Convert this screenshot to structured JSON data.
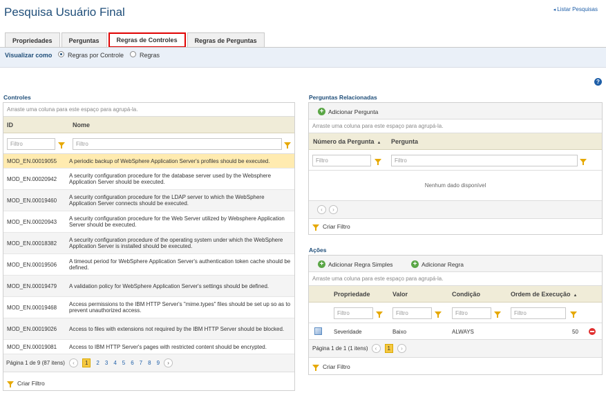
{
  "title": "Pesquisa Usuário Final",
  "top_link": "Listar Pesquisas",
  "tabs": [
    "Propriedades",
    "Perguntas",
    "Regras de Controles",
    "Regras de Perguntas"
  ],
  "view": {
    "label": "Visualizar como",
    "opt1": "Regras por Controle",
    "opt2": "Regras"
  },
  "help": "?",
  "controles": {
    "title": "Controles",
    "group_hint": "Arraste uma coluna para este espaço para agrupá-la.",
    "col_id": "ID",
    "col_nome": "Nome",
    "filter_placeholder": "Filtro",
    "rows": [
      {
        "id": "MOD_EN.00019055",
        "nome": "A periodic backup of WebSphere Application Server's profiles should be executed."
      },
      {
        "id": "MOD_EN.00020942",
        "nome": "A security configuration procedure for the database server used by the Websphere Application Server should be executed."
      },
      {
        "id": "MOD_EN.00019460",
        "nome": "A security configuration procedure for the LDAP server to which the WebSphere Application Server connects should be executed."
      },
      {
        "id": "MOD_EN.00020943",
        "nome": "A security configuration procedure for the Web Server utilized by Websphere Application Server should be executed."
      },
      {
        "id": "MOD_EN.00018382",
        "nome": "A security configuration procedure of the operating system under which the WebSphere Application Server is installed should be executed."
      },
      {
        "id": "MOD_EN.00019506",
        "nome": "A timeout period for WebSphere Application Server's authentication token cache should be defined."
      },
      {
        "id": "MOD_EN.00019479",
        "nome": "A validation policy for WebSphere Application Server's settings should be defined."
      },
      {
        "id": "MOD_EN.00019468",
        "nome": "Access permissions to the IBM HTTP Server's \"mime.types\" files should be set up so as to prevent unauthorized access."
      },
      {
        "id": "MOD_EN.00019026",
        "nome": "Access to files with extensions not required by the IBM HTTP Server should be blocked."
      },
      {
        "id": "MOD_EN.00019081",
        "nome": "Access to IBM HTTP Server's pages with restricted content should be encrypted."
      }
    ],
    "pager_text": "Página 1 de 9 (87 itens)",
    "pages": [
      "1",
      "2",
      "3",
      "4",
      "5",
      "6",
      "7",
      "8",
      "9"
    ],
    "criar_filtro": "Criar Filtro"
  },
  "perguntas": {
    "title": "Perguntas Relacionadas",
    "add": "Adicionar Pergunta",
    "group_hint": "Arraste uma coluna para este espaço para agrupá-la.",
    "col_num": "Número da Pergunta",
    "col_perg": "Pergunta",
    "filter_placeholder": "Filtro",
    "empty": "Nenhum dado disponível",
    "criar_filtro": "Criar Filtro"
  },
  "acoes": {
    "title": "Ações",
    "add_simple": "Adicionar Regra Simples",
    "add": "Adicionar Regra",
    "group_hint": "Arraste uma coluna para este espaço para agrupá-la.",
    "cols": [
      "Propriedade",
      "Valor",
      "Condição",
      "Ordem de Execução"
    ],
    "filter_placeholder": "Filtro",
    "row": {
      "propriedade": "Severidade",
      "valor": "Baixo",
      "condicao": "ALWAYS",
      "ordem": "50"
    },
    "pager_text": "Página 1 de 1 (1 itens)",
    "page": "1",
    "criar_filtro": "Criar Filtro"
  }
}
